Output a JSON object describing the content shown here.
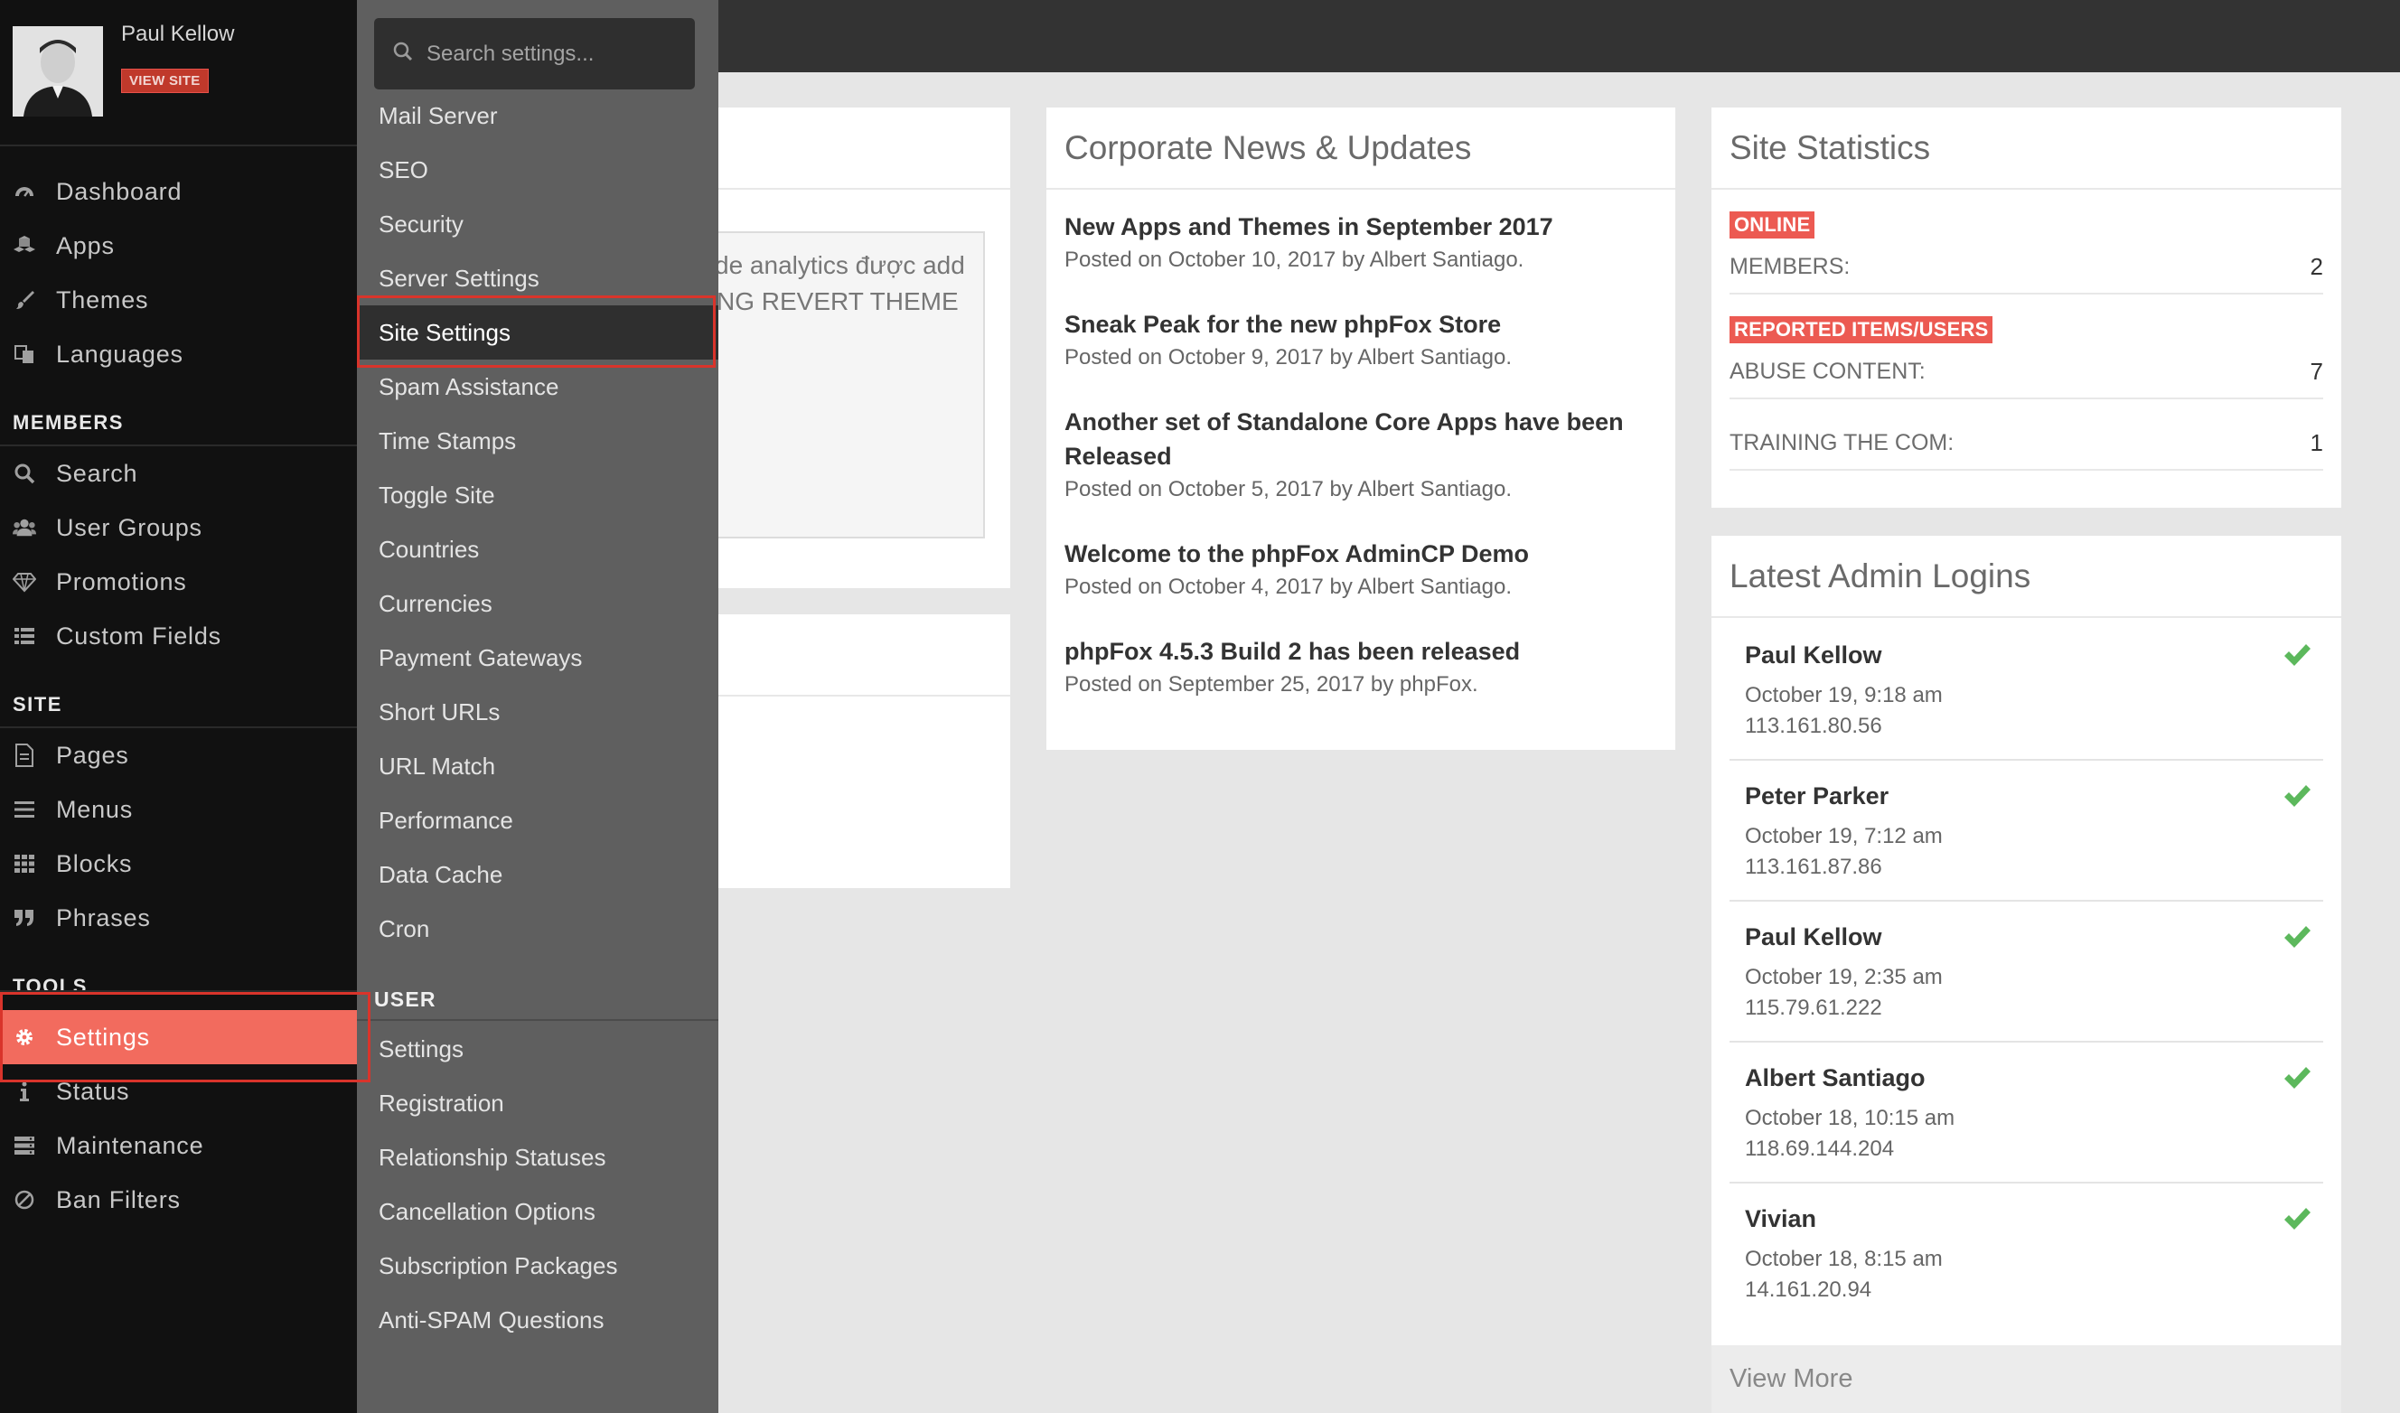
{
  "profile": {
    "name": "Paul Kellow",
    "view_site": "VIEW SITE"
  },
  "sidebar": {
    "main": [
      {
        "label": "Dashboard",
        "icon": "dashboard-icon"
      },
      {
        "label": "Apps",
        "icon": "apps-icon"
      },
      {
        "label": "Themes",
        "icon": "brush-icon"
      },
      {
        "label": "Languages",
        "icon": "languages-icon"
      }
    ],
    "members_title": "MEMBERS",
    "members": [
      {
        "label": "Search",
        "icon": "search-icon"
      },
      {
        "label": "User Groups",
        "icon": "users-icon"
      },
      {
        "label": "Promotions",
        "icon": "diamond-icon"
      },
      {
        "label": "Custom Fields",
        "icon": "list-icon"
      }
    ],
    "site_title": "SITE",
    "site": [
      {
        "label": "Pages",
        "icon": "page-icon"
      },
      {
        "label": "Menus",
        "icon": "menu-icon"
      },
      {
        "label": "Blocks",
        "icon": "blocks-icon"
      },
      {
        "label": "Phrases",
        "icon": "quote-icon"
      }
    ],
    "tools_title": "TOOLS",
    "tools": [
      {
        "label": "Settings",
        "icon": "gear-icon"
      },
      {
        "label": "Status",
        "icon": "info-icon"
      },
      {
        "label": "Maintenance",
        "icon": "server-icon"
      },
      {
        "label": "Ban Filters",
        "icon": "ban-icon"
      }
    ]
  },
  "submenu": {
    "search_placeholder": "Search settings...",
    "items": [
      "Mail Server",
      "SEO",
      "Security",
      "Server Settings",
      "Site Settings",
      "Spam Assistance",
      "Time Stamps",
      "Toggle Site",
      "Countries",
      "Currencies",
      "Payment Gateways",
      "Short URLs",
      "URL Match",
      "Performance",
      "Data Cache",
      "Cron"
    ],
    "user_title": "USER",
    "user_items": [
      "Settings",
      "Registration",
      "Relationship Statuses",
      "Cancellation Options",
      "Subscription Packages",
      "Anti-SPAM Questions"
    ]
  },
  "left_card": {
    "line1": "de analytics được add",
    "line2": "NG REVERT THEME"
  },
  "news": {
    "title": "Corporate News & Updates",
    "items": [
      {
        "title": "New Apps and Themes in September 2017",
        "meta": "Posted on October 10, 2017 by Albert Santiago."
      },
      {
        "title": "Sneak Peak for the new phpFox Store",
        "meta": "Posted on October 9, 2017 by Albert Santiago."
      },
      {
        "title": "Another set of Standalone Core Apps have been Released",
        "meta": "Posted on October 5, 2017 by Albert Santiago."
      },
      {
        "title": "Welcome to the phpFox AdminCP Demo",
        "meta": "Posted on October 4, 2017 by Albert Santiago."
      },
      {
        "title": "phpFox 4.5.3 Build 2 has been released",
        "meta": "Posted on September 25, 2017 by phpFox."
      }
    ]
  },
  "stats": {
    "title": "Site Statistics",
    "online_badge": "ONLINE",
    "members_label": "MEMBERS:",
    "members_value": "2",
    "reported_badge": "REPORTED ITEMS/USERS",
    "abuse_label": "ABUSE CONTENT:",
    "abuse_value": "7",
    "training_label": "TRAINING THE COM:",
    "training_value": "1"
  },
  "logins": {
    "title": "Latest Admin Logins",
    "items": [
      {
        "name": "Paul Kellow",
        "time": "October 19, 9:18 am",
        "ip": "113.161.80.56"
      },
      {
        "name": "Peter Parker",
        "time": "October 19, 7:12 am",
        "ip": "113.161.87.86"
      },
      {
        "name": "Paul Kellow",
        "time": "October 19, 2:35 am",
        "ip": "115.79.61.222"
      },
      {
        "name": "Albert Santiago",
        "time": "October 18, 10:15 am",
        "ip": "118.69.144.204"
      },
      {
        "name": "Vivian",
        "time": "October 18, 8:15 am",
        "ip": "14.161.20.94"
      }
    ],
    "view_more": "View More"
  },
  "colors": {
    "accent": "#f26b5e",
    "highlight": "#d9342b",
    "success": "#5cb85c"
  }
}
